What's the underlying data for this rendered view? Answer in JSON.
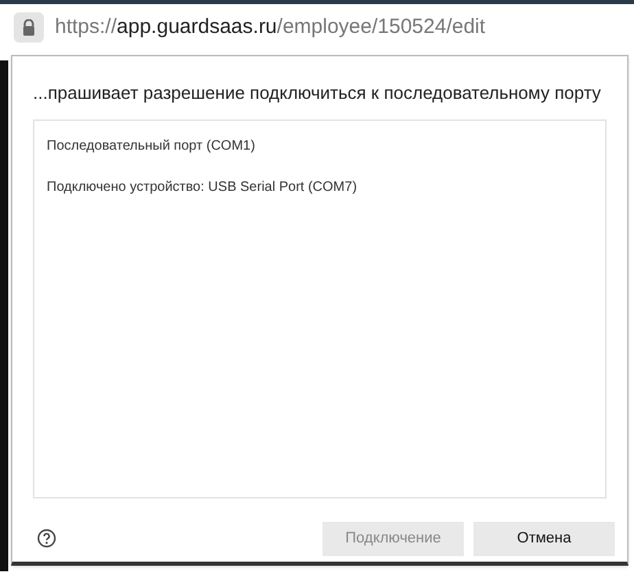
{
  "address_bar": {
    "url": "https://**app.guardsaas.ru**/employee/150524/edit"
  },
  "dialog": {
    "title": "...прашивает разрешение подключиться к последовательному порту",
    "ports": [
      {
        "label": "Последовательный порт (COM1)",
        "selected": false
      },
      {
        "label": "Подключено устройство: USB Serial Port (COM7)",
        "selected": false
      }
    ],
    "buttons": [
      {
        "label": "Подключение",
        "disabled": true
      },
      {
        "label": "Отмена",
        "disabled": false
      }
    ]
  }
}
